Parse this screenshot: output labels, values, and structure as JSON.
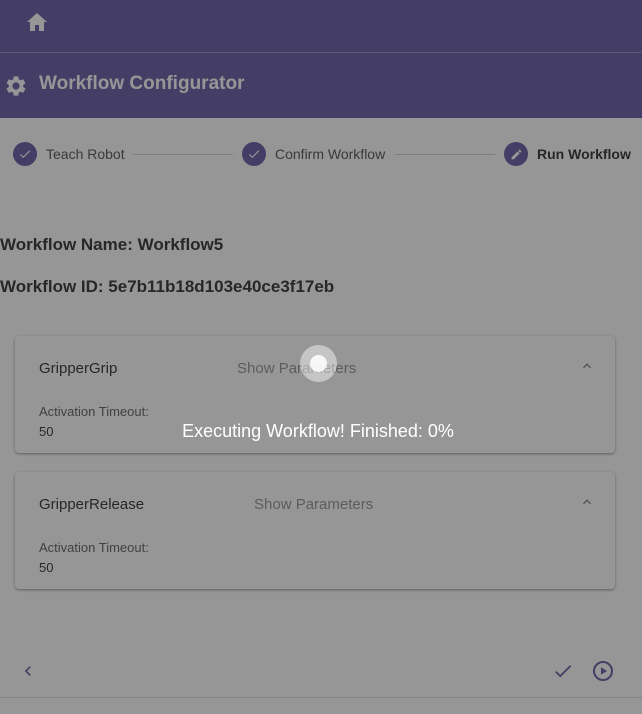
{
  "header": {
    "home_icon": "home-icon",
    "title": "Workflow Configurator",
    "title_icon": "gear-icon",
    "bar_color": "#5b4ea0"
  },
  "stepper": {
    "steps": [
      {
        "label": "Teach Robot",
        "icon": "check-icon",
        "state": "completed"
      },
      {
        "label": "Confirm Workflow",
        "icon": "check-icon",
        "state": "completed"
      },
      {
        "label": "Run Workflow",
        "icon": "pencil-icon",
        "state": "active"
      }
    ]
  },
  "workflow": {
    "name_line": "Workflow Name: Workflow5",
    "id_line": "Workflow ID: 5e7b11b18d103e40ce3f17eb"
  },
  "actions": [
    {
      "name": "GripperGrip",
      "toggle": "Show Parameters",
      "param_label": "Activation Timeout:",
      "param_value": "50",
      "chevron": "chevron-up-icon"
    },
    {
      "name": "GripperRelease",
      "toggle": "Show Parameters",
      "param_label": "Activation Timeout:",
      "param_value": "50",
      "chevron": "chevron-up-icon"
    }
  ],
  "footer": {
    "back_icon": "chevron-left-icon",
    "confirm_icon": "check-icon",
    "run_icon": "play-circle-icon"
  },
  "overlay": {
    "message": "Executing Workflow! Finished: 0%",
    "progress_percent": 0,
    "spinner_icon": "spinner-icon"
  }
}
